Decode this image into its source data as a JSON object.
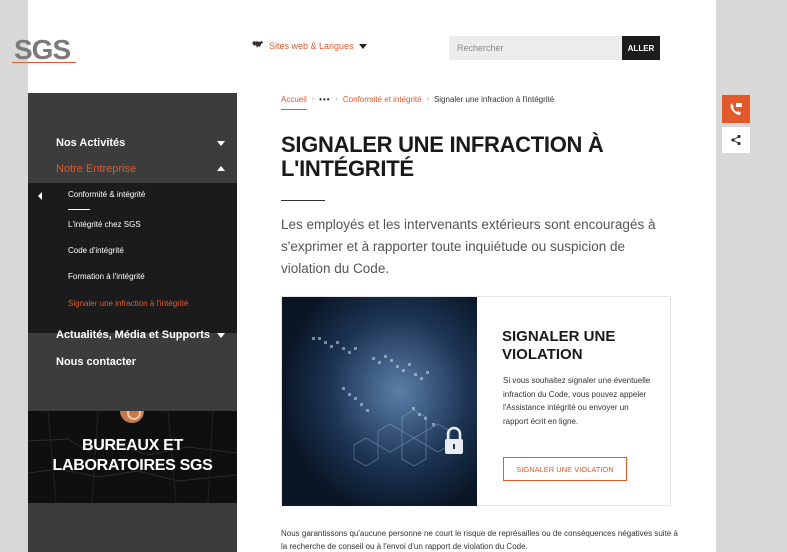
{
  "header": {
    "logo": "SGS",
    "sites_label": "Sites web & Langues",
    "search_placeholder": "Rechercher",
    "search_button": "ALLER"
  },
  "sidebar": {
    "items": [
      {
        "label": "Nos Activités"
      },
      {
        "label": "Notre Entreprise"
      },
      {
        "label": "Actualités, Média et Supports"
      },
      {
        "label": "Nous contacter"
      }
    ],
    "subitems": [
      {
        "label": "Conformité & intégrité"
      },
      {
        "label": "L'intégrité chez SGS"
      },
      {
        "label": "Code d'intégrité"
      },
      {
        "label": "Formation à l'intégrité"
      },
      {
        "label": "Signaler une infraction à l'intégrité"
      }
    ],
    "promo_title_line1": "BUREAUX ET",
    "promo_title_line2": "LABORATOIRES SGS"
  },
  "breadcrumb": {
    "home": "Accueil",
    "ellipsis": "•••",
    "parent": "Conformité et intégrité",
    "current": "Signaler une infraction à l'intégrité"
  },
  "main": {
    "title": "SIGNALER UNE INFRACTION À L'INTÉGRITÉ",
    "lead": "Les employés et les intervenants extérieurs sont encouragés à s'exprimer et à rapporter toute inquiétude ou suspicion de violation du Code.",
    "card": {
      "title": "SIGNALER UNE VIOLATION",
      "text": "Si vous souhaitez signaler une éventuelle infraction du Code, vous pouvez appeler l'Assistance intégrité ou envoyer un rapport écrit en ligne.",
      "button": "SIGNALER UNE VIOLATION"
    },
    "footer": "Nous garantissons qu'aucune personne ne court le risque de représailles ou de conséquences négatives suite à la recherche de conseil ou à l'envoi d'un rapport de violation du Code."
  },
  "colors": {
    "accent": "#e2592b",
    "sidebar_bg": "#3c3c3c",
    "subnav_bg": "#1b1b1b"
  }
}
